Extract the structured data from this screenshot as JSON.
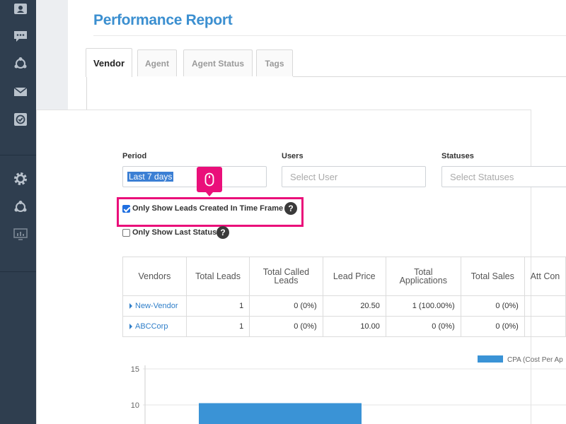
{
  "page": {
    "title": "Performance Report"
  },
  "tabs": [
    {
      "label": "Vendor"
    },
    {
      "label": "Agent"
    },
    {
      "label": "Agent Status"
    },
    {
      "label": "Tags"
    }
  ],
  "filters": {
    "period": {
      "label": "Period",
      "value": "Last 7 days"
    },
    "users": {
      "label": "Users",
      "placeholder": "Select User"
    },
    "statuses": {
      "label": "Statuses",
      "placeholder": "Select Statuses"
    }
  },
  "options": {
    "time_frame": {
      "label": "Only Show Leads Created In Time Frame",
      "checked": true
    },
    "last_status": {
      "label": "Only Show Last Status",
      "checked": false
    }
  },
  "help_glyph": "?",
  "table": {
    "headers": [
      "Vendors",
      "Total Leads",
      "Total Called Leads",
      "Lead Price",
      "Total Applications",
      "Total Sales",
      "Att Con"
    ],
    "rows": [
      [
        "New-Vendor",
        "1",
        "0 (0%)",
        "20.50",
        "1 (100.00%)",
        "0 (0%)",
        ""
      ],
      [
        "ABCCorp",
        "1",
        "0 (0%)",
        "10.00",
        "0 (0%)",
        "0 (0%)",
        ""
      ]
    ]
  },
  "chart_data": {
    "type": "bar",
    "legend": [
      "CPA (Cost Per Ap"
    ],
    "yticks": [
      "15",
      "10"
    ],
    "series": [
      {
        "name": "CPA (Cost Per Ap",
        "values": [
          10.25
        ]
      }
    ],
    "ylim": [
      5,
      15
    ],
    "bar_color": "#3a93d6"
  },
  "colors": {
    "sidebar": "#2f3e4f",
    "accent": "#3b8fd0",
    "highlight": "#ea0f7a"
  }
}
